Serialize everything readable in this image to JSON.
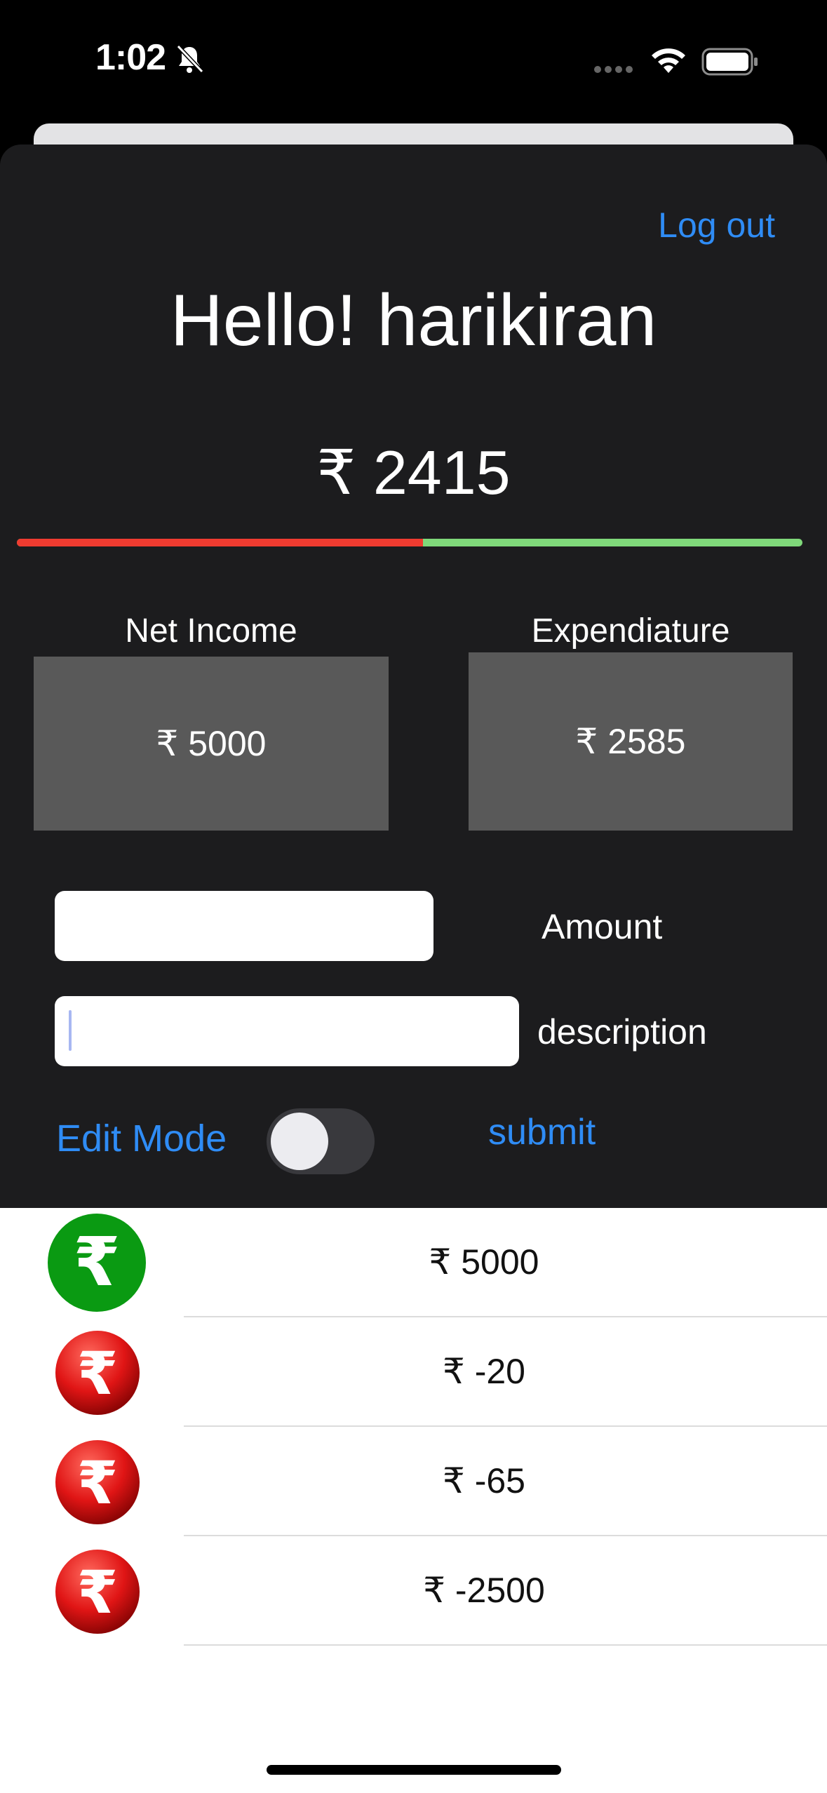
{
  "status_bar": {
    "time": "1:02"
  },
  "header": {
    "logout_label": "Log out",
    "greeting": "Hello! harikiran"
  },
  "balance": {
    "text": "₹ 2415",
    "spent_fraction": 0.517
  },
  "cards": {
    "income": {
      "label": "Net Income",
      "value": "₹ 5000"
    },
    "expense": {
      "label": "Expendiature",
      "value": "₹ 2585"
    }
  },
  "form": {
    "amount_value": "",
    "amount_label": "Amount",
    "description_value": "",
    "description_label": "description",
    "edit_mode_label": "Edit Mode",
    "edit_mode_on": false,
    "submit_label": "submit"
  },
  "transactions": [
    {
      "amount": "₹ 5000",
      "type": "income",
      "color": "#0a9a12"
    },
    {
      "amount": "₹ -20",
      "type": "expense",
      "color": "#e01515"
    },
    {
      "amount": "₹ -65",
      "type": "expense",
      "color": "#e01515"
    },
    {
      "amount": "₹ -2500",
      "type": "expense",
      "color": "#e01515"
    }
  ],
  "colors": {
    "accent": "#2f8cf5",
    "progress_spent": "#ef3b30",
    "progress_remaining": "#7fd87a",
    "sheet_background": "#1c1c1e",
    "card_background": "#595959"
  }
}
